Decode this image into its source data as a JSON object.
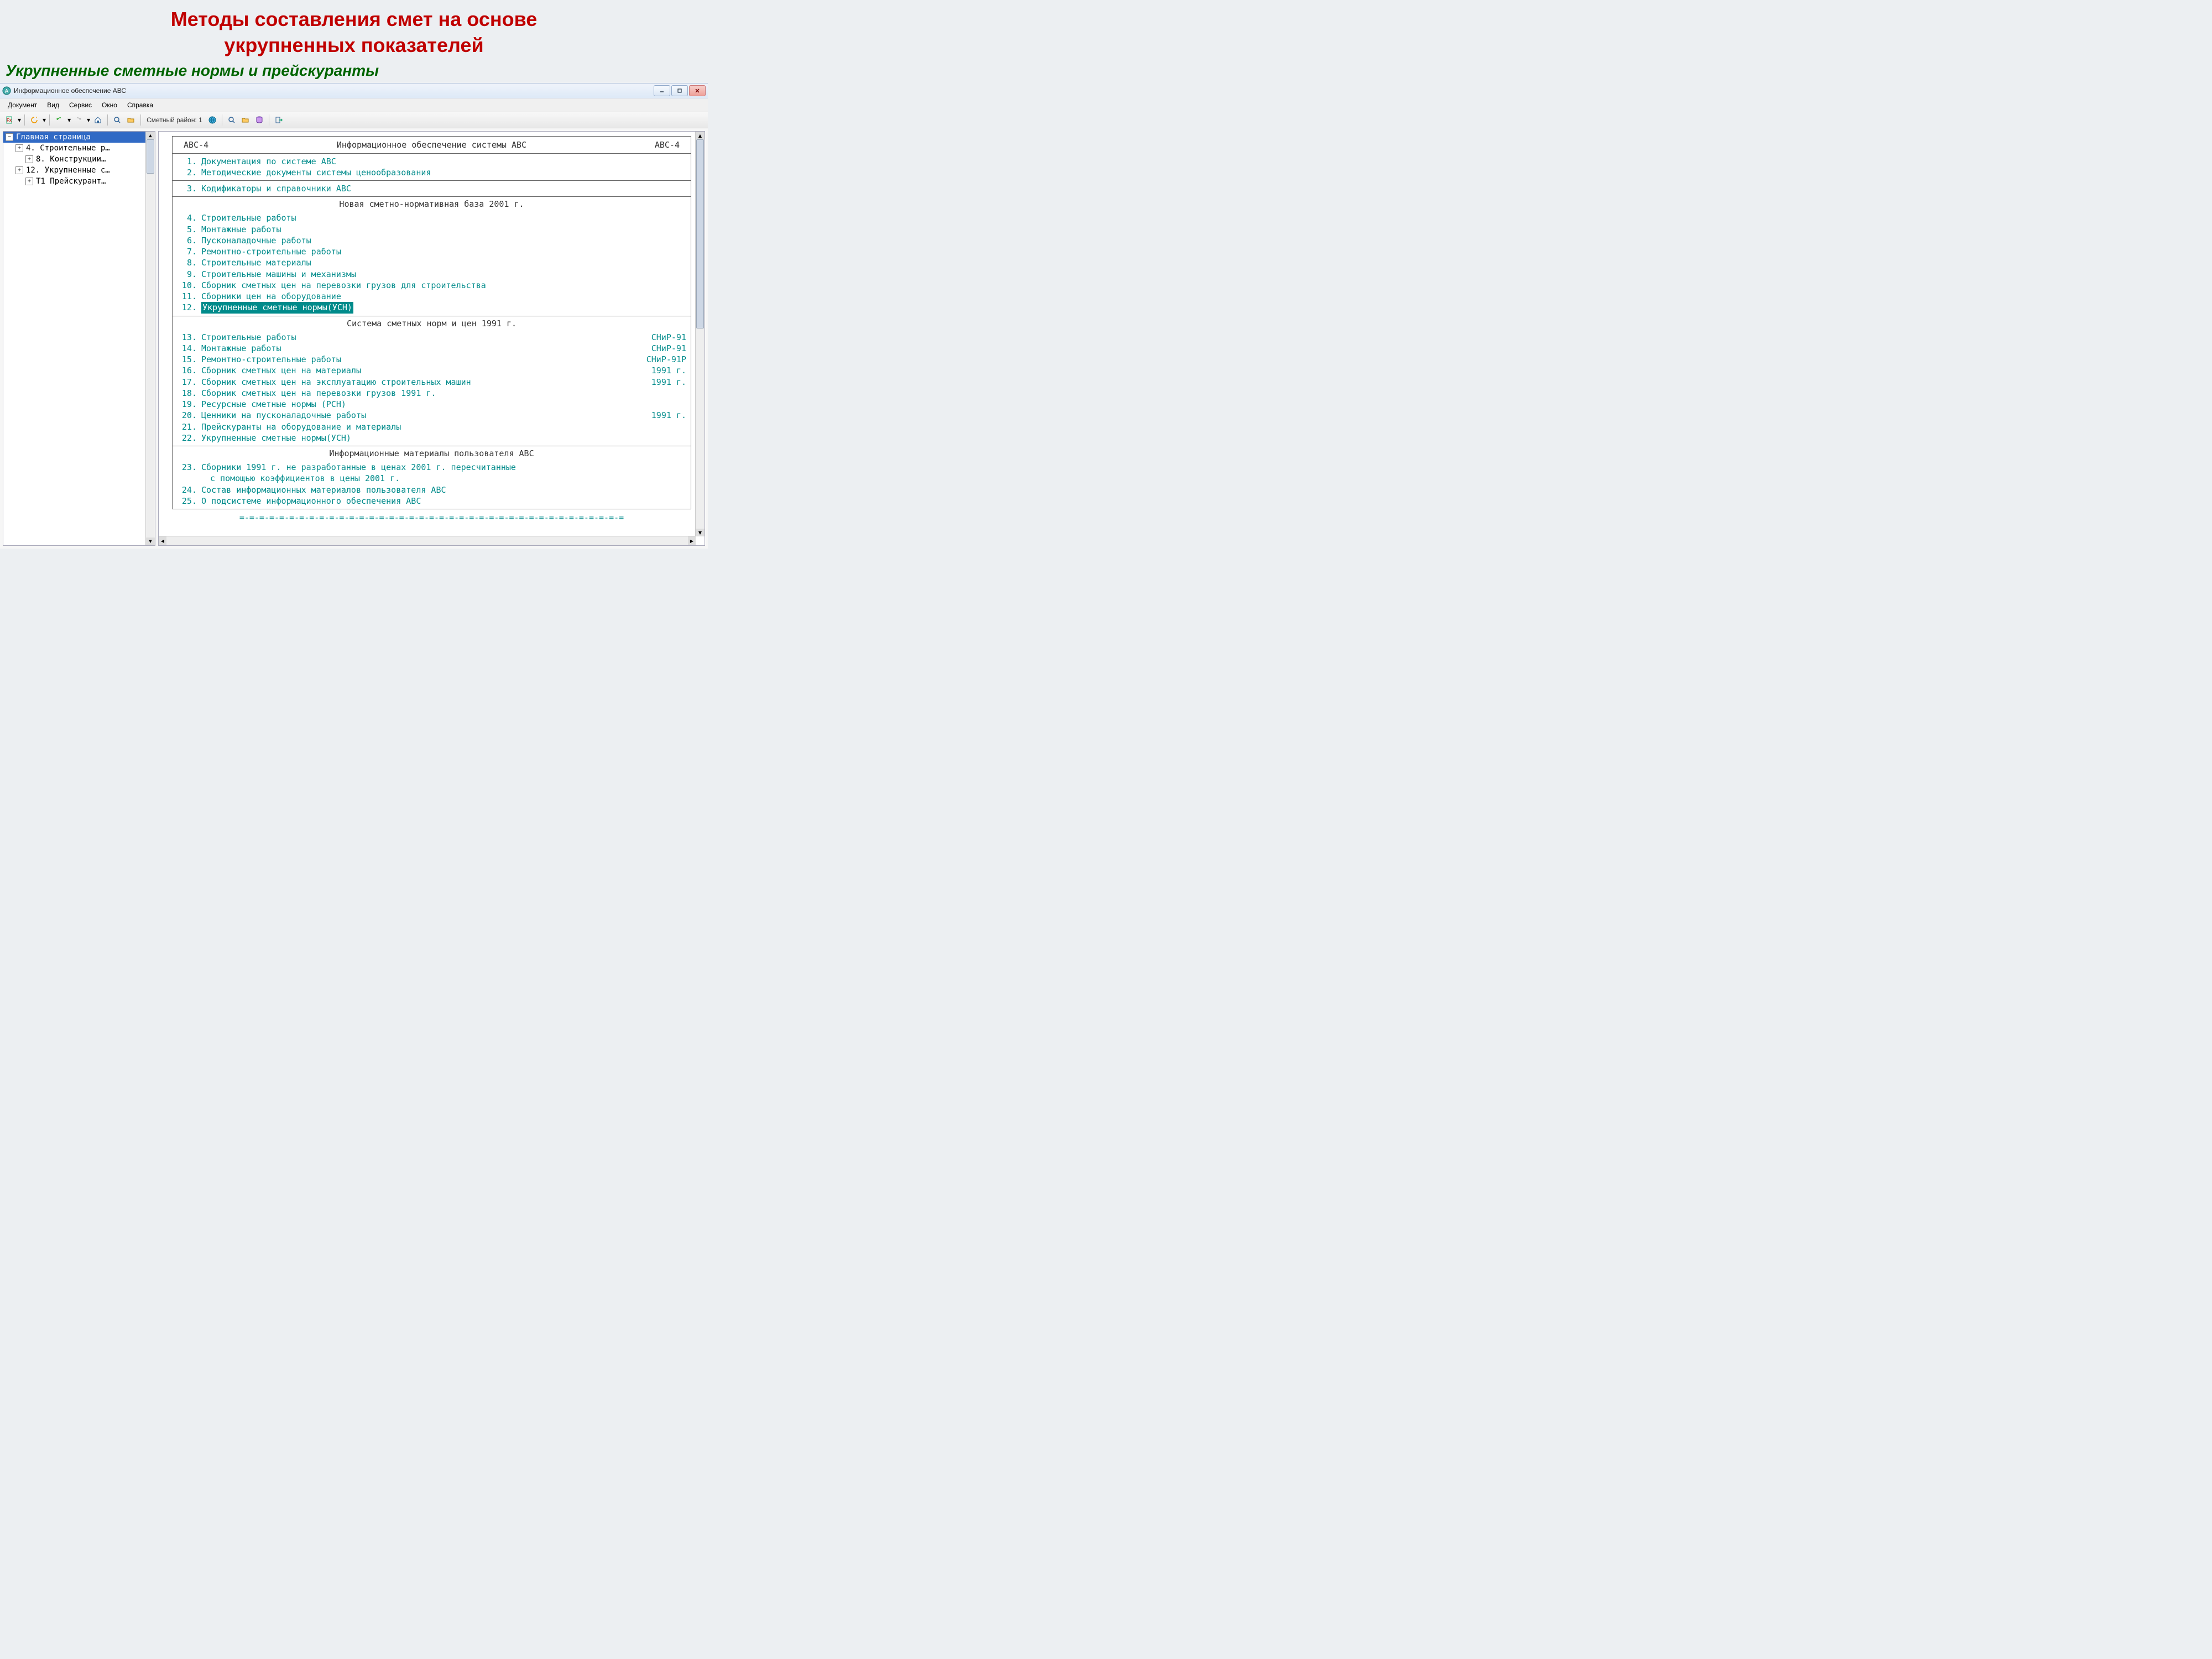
{
  "slide": {
    "title_line1": "Методы составления смет на основе",
    "title_line2": "укрупненных показателей",
    "subtitle": "Укрупненные сметные нормы и прейскуранты"
  },
  "window": {
    "title": "Информационное обеспечение АВС"
  },
  "menubar": [
    "Документ",
    "Вид",
    "Сервис",
    "Окно",
    "Справка"
  ],
  "toolbar": {
    "region_label": "Сметный район: 1"
  },
  "tree": {
    "root": "Главная страница",
    "items": [
      {
        "indent": 1,
        "label": "4. Строительные р…"
      },
      {
        "indent": 2,
        "label": "8. Конструкции…"
      },
      {
        "indent": 1,
        "label": "12. Укрупненные с…"
      },
      {
        "indent": 2,
        "label": "Т1 Прейскурант…"
      }
    ]
  },
  "main": {
    "header_left": "АВС-4",
    "header_center": "Информационное обеспечение системы АВС",
    "header_right": "АВС-4",
    "block1": [
      {
        "num": "1.",
        "label": "Документация по системе АВС"
      },
      {
        "num": "2.",
        "label": "Методические документы системы ценообразования"
      }
    ],
    "block2": [
      {
        "num": "3.",
        "label": "Кодификаторы и справочники АВС"
      }
    ],
    "block3_title": "Новая сметно-нормативная база 2001 г.",
    "block3": [
      {
        "num": "4.",
        "label": "Строительные работы"
      },
      {
        "num": "5.",
        "label": "Монтажные работы"
      },
      {
        "num": "6.",
        "label": "Пусконаладочные работы"
      },
      {
        "num": "7.",
        "label": "Ремонтно-строительные работы"
      },
      {
        "num": "8.",
        "label": "Строительные материалы"
      },
      {
        "num": "9.",
        "label": "Строительные машины и механизмы"
      },
      {
        "num": "10.",
        "label": "Сборник сметных цен на перевозки грузов для строительства"
      },
      {
        "num": "11.",
        "label": "Сборники цен на оборудование"
      },
      {
        "num": "12.",
        "label": "Укрупненные сметные нормы(УСН)",
        "highlighted": true
      }
    ],
    "block4_title": "Система сметных норм и цен 1991 г.",
    "block4": [
      {
        "num": "13.",
        "label": "Строительные работы",
        "right": "СНиР-91"
      },
      {
        "num": "14.",
        "label": "Монтажные работы",
        "right": "СНиР-91"
      },
      {
        "num": "15.",
        "label": "Ремонтно-строительные работы",
        "right": "СНиР-91Р"
      },
      {
        "num": "16.",
        "label": "Сборник сметных цен на материалы",
        "right": "1991 г."
      },
      {
        "num": "17.",
        "label": "Сборник сметных цен на эксплуатацию строительных машин",
        "right": "1991 г."
      },
      {
        "num": "18.",
        "label": "Сборник сметных цен на перевозки грузов 1991 г."
      },
      {
        "num": "19.",
        "label": "Ресурсные сметные нормы (РСН)"
      },
      {
        "num": "20.",
        "label": "Ценники на пусконаладочные работы",
        "right": "1991 г."
      },
      {
        "num": "21.",
        "label": "Прейскуранты на оборудование и материалы"
      },
      {
        "num": "22.",
        "label": "Укрупненные сметные нормы(УСН)"
      }
    ],
    "block5_title": "Информационные материалы пользователя АВС",
    "block5": [
      {
        "num": "23.",
        "label": "Сборники 1991 г. не разработанные в ценах 2001 г. пересчитанные",
        "cont": "с помощью коэффициентов в цены 2001 г."
      },
      {
        "num": "24.",
        "label": "Состав информационных материалов пользователя АВС"
      },
      {
        "num": "25.",
        "label": "О подсистеме информационного обеспечения АВС"
      }
    ],
    "footer_sep": "=-=-=-=-=-=-=-=-=-=-=-=-=-=-=-=-=-=-=-=-=-=-=-=-=-=-=-=-=-=-=-=-=-=-=-=-=-=-="
  }
}
